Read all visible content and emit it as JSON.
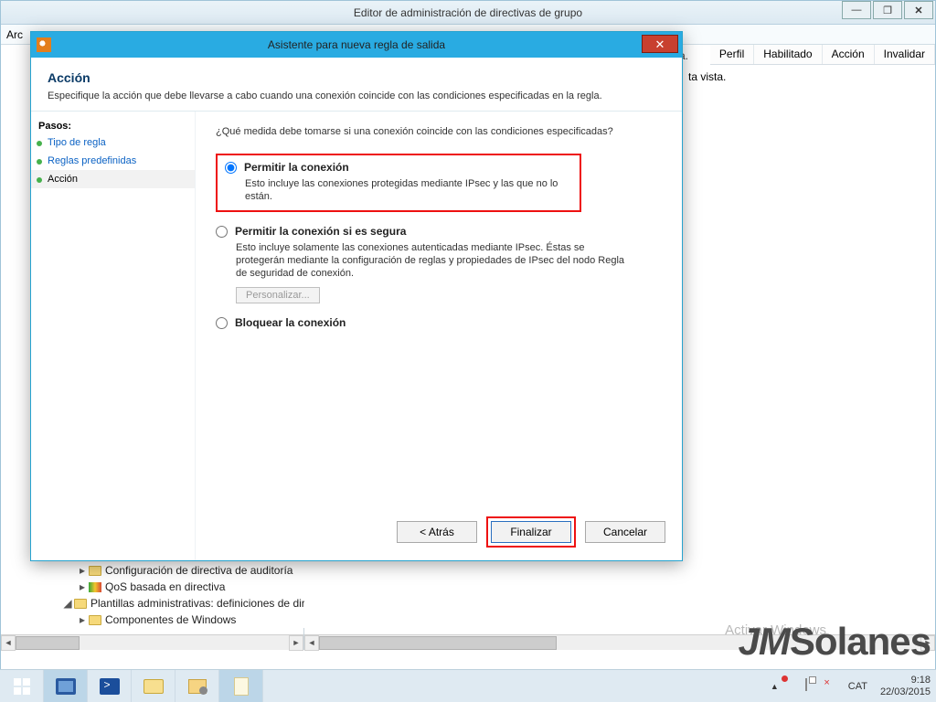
{
  "main_window": {
    "title": "Editor de administración de directivas de grupo",
    "ctrl_min": "—",
    "ctrl_max": "❐",
    "ctrl_close": "✕",
    "menubar_fragment": "Arc"
  },
  "tree": {
    "n1": "Configuración de directiva de auditoría",
    "n2": "QoS basada en directiva",
    "n3": "Plantillas administrativas: definiciones de directiva",
    "n4": "Componentes de Windows"
  },
  "right_table": {
    "cols": [
      "Perfil",
      "Habilitado",
      "Acción",
      "Invalidar"
    ],
    "msg_fragment": "ta vista."
  },
  "wizard": {
    "title": "Asistente para nueva regla de salida",
    "header": "Acción",
    "subheader": "Especifique la acción que debe llevarse a cabo cuando una conexión coincide con las condiciones especificadas en la regla.",
    "steps_label": "Pasos:",
    "steps": {
      "s1": "Tipo de regla",
      "s2": "Reglas predefinidas",
      "s3": "Acción"
    },
    "prompt": "¿Qué medida debe tomarse si una conexión coincide con las condiciones especificadas?",
    "opt1": {
      "label": "Permitir la conexión",
      "desc": "Esto incluye las conexiones protegidas mediante IPsec y las que no lo están."
    },
    "opt2": {
      "label": "Permitir la conexión si es segura",
      "desc": "Esto incluye solamente las conexiones autenticadas mediante IPsec. Éstas se protegerán mediante la configuración de reglas y propiedades de IPsec del nodo Regla de seguridad de conexión.",
      "customize": "Personalizar..."
    },
    "opt3": {
      "label": "Bloquear la conexión"
    },
    "btn_back": "< Atrás",
    "btn_finish": "Finalizar",
    "btn_cancel": "Cancelar"
  },
  "activation": "Activar Windows",
  "brand": "JMSolanes",
  "taskbar": {
    "lang": "CAT",
    "time": "9:18",
    "date": "22/03/2015",
    "up_arrow": "▲"
  }
}
